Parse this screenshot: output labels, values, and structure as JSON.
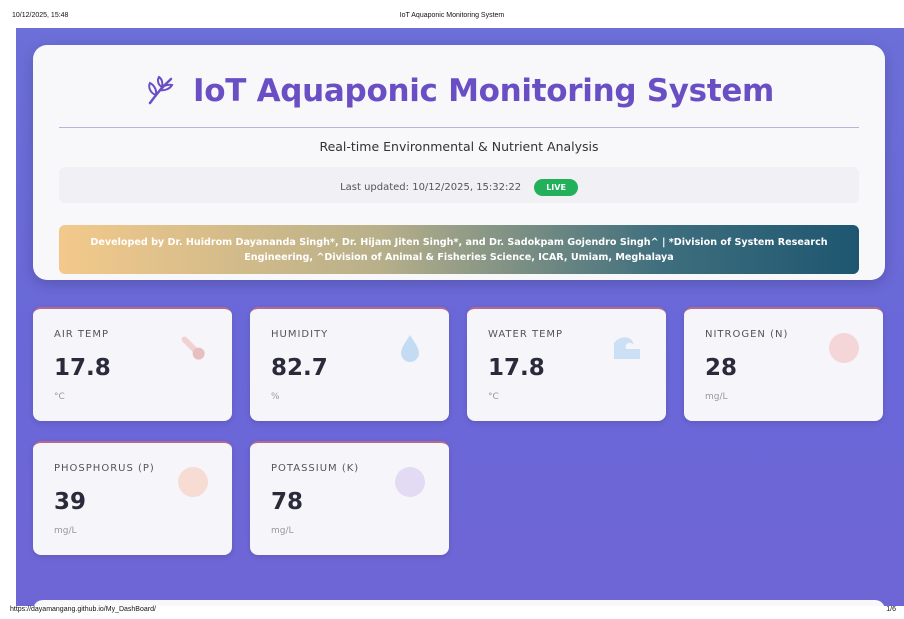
{
  "print_header": {
    "timestamp": "10/12/2025, 15:48",
    "document_title": "IoT Aquaponic Monitoring System"
  },
  "print_footer": {
    "url": "https://dayamangang.github.io/My_DashBoard/",
    "page": "1/6"
  },
  "header": {
    "title": "IoT Aquaponic Monitoring System",
    "title_icon": "plant-sprout-icon",
    "subtitle": "Real-time Environmental & Nutrient Analysis",
    "last_updated": "Last updated: 10/12/2025, 15:32:22",
    "live_badge": "LIVE",
    "credits": "Developed by Dr. Huidrom Dayananda Singh*, Dr. Hijam Jiten Singh*, and Dr. Sadokpam Gojendro Singh^ | *Division of System Research Engineering, ^Division of Animal & Fisheries Science, ICAR, Umiam, Meghalaya"
  },
  "metrics": [
    {
      "label": "AIR TEMP",
      "value": "17.8",
      "unit": "°C",
      "icon": "thermometer-icon"
    },
    {
      "label": "HUMIDITY",
      "value": "82.7",
      "unit": "%",
      "icon": "water-drop-icon"
    },
    {
      "label": "WATER TEMP",
      "value": "17.8",
      "unit": "°C",
      "icon": "wave-icon"
    },
    {
      "label": "NITROGEN (N)",
      "value": "28",
      "unit": "mg/L",
      "icon": "red-circle-icon"
    },
    {
      "label": "PHOSPHORUS (P)",
      "value": "39",
      "unit": "mg/L",
      "icon": "orange-circle-icon"
    },
    {
      "label": "POTASSIUM (K)",
      "value": "78",
      "unit": "mg/L",
      "icon": "purple-circle-icon"
    }
  ],
  "colors": {
    "background": "#6c6fd8",
    "title": "#6a4fc4",
    "live": "#22b05a",
    "card_accent": "#b46a8e"
  }
}
